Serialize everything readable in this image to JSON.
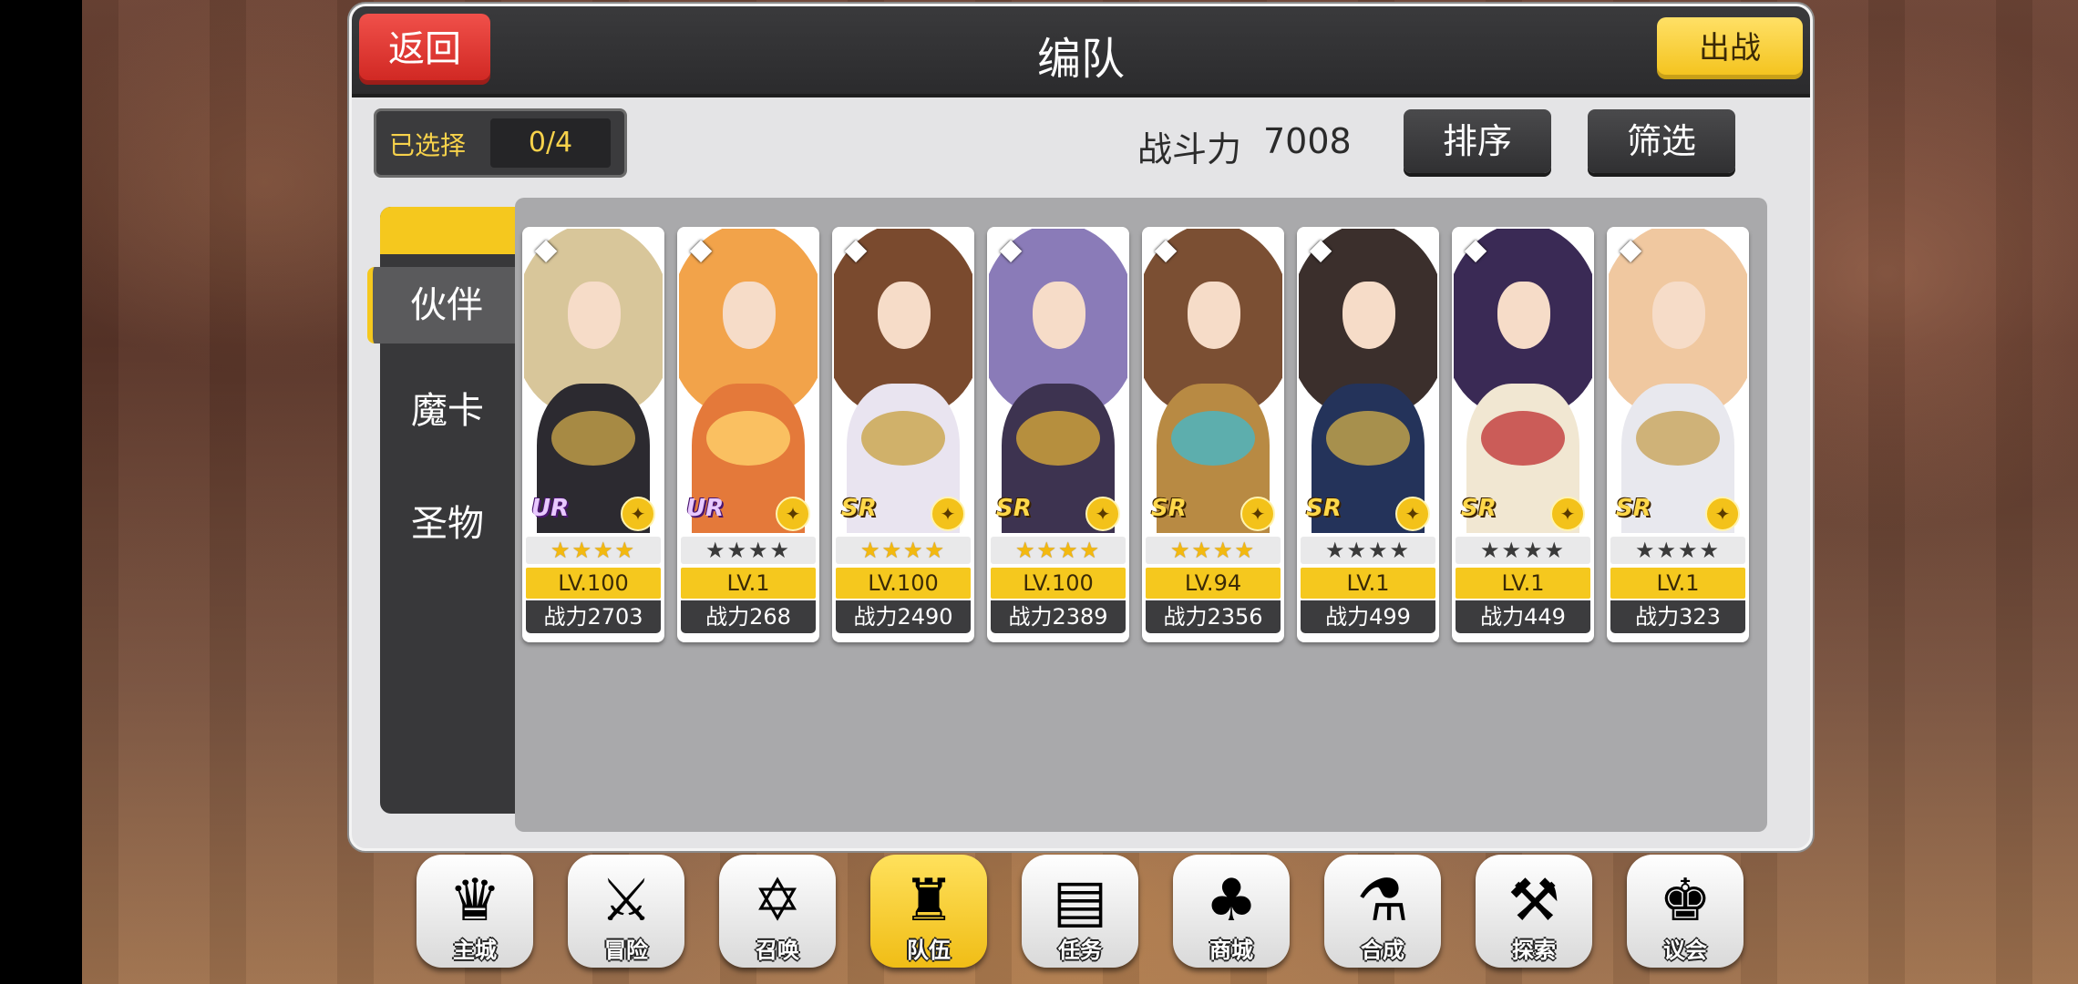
{
  "header": {
    "title": "编队",
    "back_label": "返回",
    "battle_label": "出战"
  },
  "selection": {
    "label": "已选择",
    "value": "0/4"
  },
  "power": {
    "label": "战斗力",
    "value": "7008"
  },
  "actions": {
    "sort_label": "排序",
    "filter_label": "筛选"
  },
  "tabs": [
    {
      "label": "伙伴",
      "active": true
    },
    {
      "label": "魔卡",
      "active": false
    },
    {
      "label": "圣物",
      "active": false
    }
  ],
  "cards": [
    {
      "rarity": "UR",
      "stars": "★★★★",
      "star_style": "gold",
      "level": "LV.100",
      "power": "战力2703",
      "gem_icon": "diamond-icon",
      "type_icon": "feather-icon",
      "hair": "#d8c69a",
      "body": "#2c2a30",
      "accent": "#c7a24a"
    },
    {
      "rarity": "UR",
      "stars": "★★★★",
      "star_style": "dark",
      "level": "LV.1",
      "power": "战力268",
      "gem_icon": "diamond-icon",
      "type_icon": "cross-icon",
      "hair": "#f2a34a",
      "body": "#e4793a",
      "accent": "#ffd26b"
    },
    {
      "rarity": "SR",
      "stars": "★★★★",
      "star_style": "gold",
      "level": "LV.100",
      "power": "战力2490",
      "gem_icon": "diamond-icon",
      "type_icon": "bow-icon",
      "hair": "#7a4a2e",
      "body": "#e9e4f0",
      "accent": "#c9a449"
    },
    {
      "rarity": "SR",
      "stars": "★★★★",
      "star_style": "gold",
      "level": "LV.100",
      "power": "战力2389",
      "gem_icon": "diamond-icon",
      "type_icon": "cross-icon",
      "hair": "#8a7bb8",
      "body": "#3d3350",
      "accent": "#d4a63a"
    },
    {
      "rarity": "SR",
      "stars": "★★★★",
      "star_style": "gold",
      "level": "LV.94",
      "power": "战力2356",
      "gem_icon": "diamond-icon",
      "type_icon": "target-icon",
      "hair": "#7b4f33",
      "body": "#b88a43",
      "accent": "#46b6c8"
    },
    {
      "rarity": "SR",
      "stars": "★★★★",
      "star_style": "dark",
      "level": "LV.1",
      "power": "战力499",
      "gem_icon": "diamond-icon",
      "type_icon": "feather-icon",
      "hair": "#3b2f2c",
      "body": "#24335a",
      "accent": "#c8a84a"
    },
    {
      "rarity": "SR",
      "stars": "★★★★",
      "star_style": "dark",
      "level": "LV.1",
      "power": "战力449",
      "gem_icon": "diamond-icon",
      "type_icon": "bow-icon",
      "hair": "#3a2a55",
      "body": "#f1e7d2",
      "accent": "#c23a3a"
    },
    {
      "rarity": "SR",
      "stars": "★★★★",
      "star_style": "dark",
      "level": "LV.1",
      "power": "战力323",
      "gem_icon": "diamond-icon",
      "type_icon": "feather-icon",
      "hair": "#f0c8a0",
      "body": "#e8e8ee",
      "accent": "#c8a45a"
    }
  ],
  "nav": [
    {
      "label": "主城",
      "icon": "crown-icon",
      "glyph": "♛",
      "active": false
    },
    {
      "label": "冒险",
      "icon": "crossed-axes-icon",
      "glyph": "⚔",
      "active": false
    },
    {
      "label": "召唤",
      "icon": "summon-card-icon",
      "glyph": "✡",
      "active": false
    },
    {
      "label": "队伍",
      "icon": "winged-crest-icon",
      "glyph": "♜",
      "active": true
    },
    {
      "label": "任务",
      "icon": "quest-book-icon",
      "glyph": "▤",
      "active": false
    },
    {
      "label": "商城",
      "icon": "shop-tree-icon",
      "glyph": "♣",
      "active": false
    },
    {
      "label": "合成",
      "icon": "potion-icon",
      "glyph": "⚗",
      "active": false
    },
    {
      "label": "探索",
      "icon": "shovel-icon",
      "glyph": "⚒",
      "active": false
    },
    {
      "label": "议会",
      "icon": "council-crest-icon",
      "glyph": "♚",
      "active": false
    }
  ]
}
